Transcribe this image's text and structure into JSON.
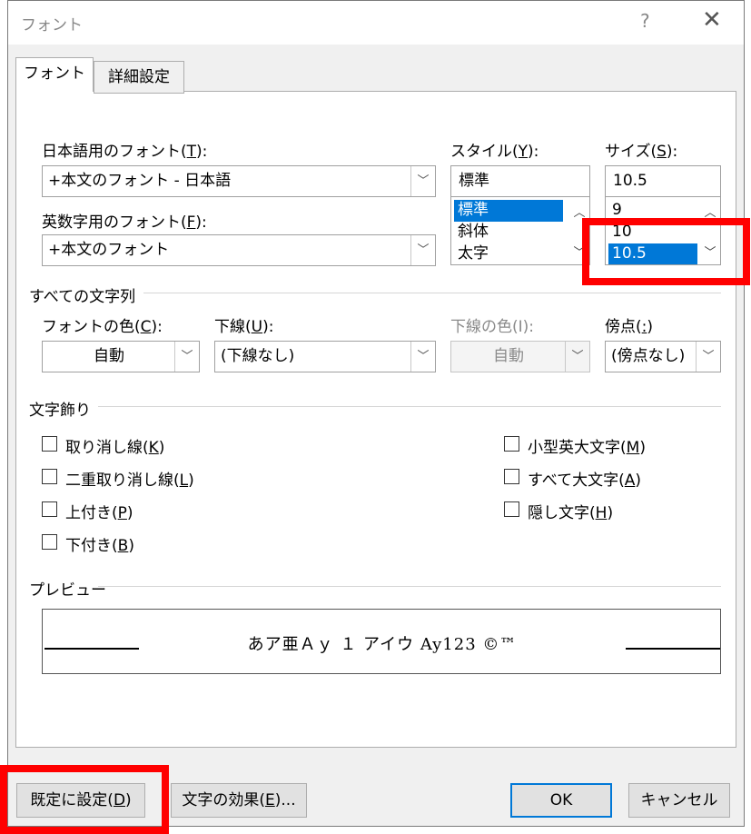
{
  "dialog": {
    "title": "フォント",
    "help": "?",
    "close": "✕"
  },
  "tabs": [
    {
      "label": "フォント",
      "active": true
    },
    {
      "label": "詳細設定",
      "active": false
    }
  ],
  "jp_font": {
    "label_text": "日本語用のフォント(",
    "label_key": "T",
    "label_end": "):",
    "value": "+本文のフォント - 日本語"
  },
  "en_font": {
    "label_text": "英数字用のフォント(",
    "label_key": "F",
    "label_end": "):",
    "value": "+本文のフォント"
  },
  "style": {
    "label_text": "スタイル(",
    "label_key": "Y",
    "label_end": "):",
    "value": "標準",
    "options": [
      "標準",
      "斜体",
      "太字"
    ],
    "selected": "標準"
  },
  "size": {
    "label_text": "サイズ(",
    "label_key": "S",
    "label_end": "):",
    "value": "10.5",
    "options": [
      "9",
      "10",
      "10.5"
    ],
    "selected": "10.5"
  },
  "all_text": {
    "title": "すべての文字列",
    "font_color": {
      "label_text": "フォントの色(",
      "label_key": "C",
      "label_end": "):",
      "value": "自動"
    },
    "underline": {
      "label_text": "下線(",
      "label_key": "U",
      "label_end": "):",
      "value": "(下線なし)"
    },
    "underline_color": {
      "label": "下線の色(I):",
      "value": "自動",
      "disabled": true
    },
    "emphasis": {
      "label_text": "傍点(",
      "label_key": ":",
      "label_end": ")",
      "value": "(傍点なし)"
    }
  },
  "effects": {
    "title": "文字飾り",
    "left": [
      {
        "text": "取り消し線(",
        "key": "K",
        "end": ")",
        "checked": false
      },
      {
        "text": "二重取り消し線(",
        "key": "L",
        "end": ")",
        "checked": false
      },
      {
        "text": "上付き(",
        "key": "P",
        "end": ")",
        "checked": false
      },
      {
        "text": "下付き(",
        "key": "B",
        "end": ")",
        "checked": false
      }
    ],
    "right": [
      {
        "text": "小型英大文字(",
        "key": "M",
        "end": ")",
        "checked": false
      },
      {
        "text": "すべて大文字(",
        "key": "A",
        "end": ")",
        "checked": false
      },
      {
        "text": "隠し文字(",
        "key": "H",
        "end": ")",
        "checked": false
      }
    ]
  },
  "preview": {
    "title": "プレビュー",
    "sample": "あア亜Ａｙ １ アイウ Ay123 ©™"
  },
  "buttons": {
    "default": {
      "text": "既定に設定(",
      "key": "D",
      "end": ")"
    },
    "text_effects": {
      "text": "文字の効果(",
      "key": "E",
      "end": ")..."
    },
    "ok": "OK",
    "cancel": "キャンセル"
  },
  "colors": {
    "highlight_box": "#ff0000",
    "selection": "#0078d7",
    "ok_border": "#0078d7"
  }
}
